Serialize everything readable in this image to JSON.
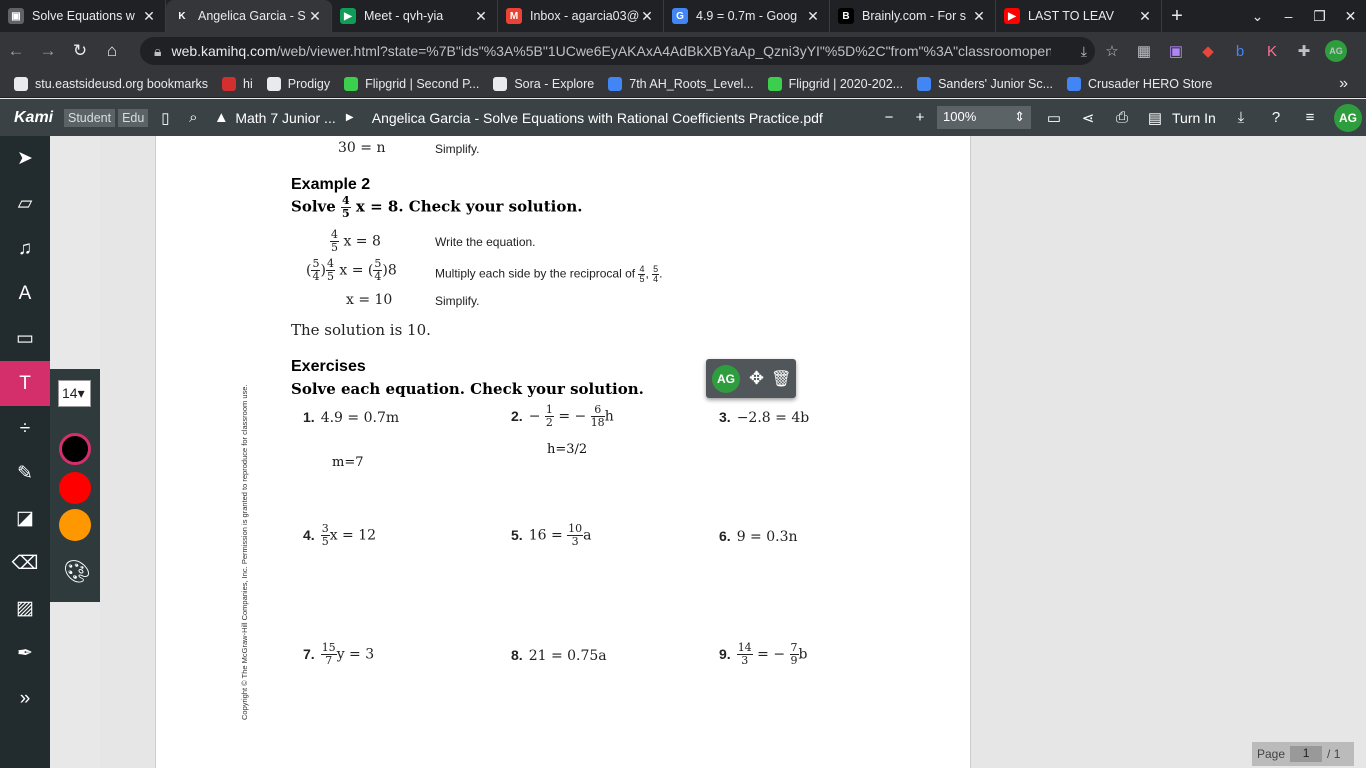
{
  "browser": {
    "tabs": [
      {
        "title": "Solve Equations w",
        "icon_color": "#5f6368",
        "icon_char": "▣"
      },
      {
        "title": "Angelica Garcia - S",
        "icon_color": "#35363a",
        "icon_char": "K"
      },
      {
        "title": "Meet - qvh-yia",
        "icon_color": "#0f9d58",
        "icon_char": "▶"
      },
      {
        "title": "Inbox - agarcia03@",
        "icon_color": "#ea4335",
        "icon_char": "M"
      },
      {
        "title": "4.9 = 0.7m - Goog",
        "icon_color": "#4285f4",
        "icon_char": "G"
      },
      {
        "title": "Brainly.com - For s",
        "icon_color": "#000000",
        "icon_char": "B"
      },
      {
        "title": "LAST TO LEAV",
        "icon_color": "#ff0000",
        "icon_char": "▶"
      }
    ],
    "url_host": "web.kamihq.com",
    "url_path": "/web/viewer.html?state=%7B\"ids\"%3A%5B\"1UCwe6EyAKAxA4AdBkXBYaAp_Qzni3yYI\"%5D%2C\"from\"%3A\"classroomopenex...",
    "bookmarks": [
      {
        "label": "stu.eastsideusd.org bookmarks",
        "color": "#e8eaed"
      },
      {
        "label": "hi",
        "color": "#d32f2f"
      },
      {
        "label": "Prodigy",
        "color": "#e8eaed"
      },
      {
        "label": "Flipgrid | Second P...",
        "color": "#3ccf4e"
      },
      {
        "label": "Sora - Explore",
        "color": "#e8eaed"
      },
      {
        "label": "7th AH_Roots_Level...",
        "color": "#4285f4"
      },
      {
        "label": "Flipgrid | 2020-202...",
        "color": "#3ccf4e"
      },
      {
        "label": "Sanders' Junior Sc...",
        "color": "#4285f4"
      },
      {
        "label": "Crusader HERO Store",
        "color": "#4285f4"
      }
    ]
  },
  "kami": {
    "logo": "Kami",
    "chip_student": "Student",
    "chip_edu": "Edu",
    "crumb_folder": "Math 7 Junior ...",
    "doc_title": "Angelica Garcia - Solve Equations with Rational Coefficients Practice.pdf",
    "zoom": "100%",
    "turn_in": "Turn In",
    "avatar": "AG",
    "font_size": "14",
    "colors": [
      "#000000",
      "#ff0000",
      "#ff9800"
    ],
    "page_label": "Page",
    "page_current": "1",
    "page_total": "/ 1"
  },
  "doc": {
    "top_eq": "30 = n",
    "top_note": "Simplify.",
    "ex2_title": "Example 2",
    "ex2_solve": "Solve",
    "ex2_rest": "x = 8. Check your solution.",
    "steps": [
      {
        "note": "Write the equation."
      },
      {
        "note": "Multiply each side by the reciprocal of"
      },
      {
        "note": "Simplify."
      }
    ],
    "step1": "x = 8",
    "step3": "x = 10",
    "solution": "The solution is 10.",
    "ex_title": "Exercises",
    "ex_instr": "Solve each equation. Check your solution.",
    "copyright": "Copyright © The McGraw-Hill Companies, Inc. Permission is granted to reproduce for classroom use.",
    "answers": {
      "a1": "m=7",
      "a2": "h=3/2"
    },
    "problems": {
      "p1": "4.9 = 0.7m",
      "p3": "−2.8 = 4b",
      "p5a": "16 =",
      "p6": "9 = 0.3n",
      "p7b": "y = 3",
      "p8": "21 = 0.75a"
    }
  }
}
